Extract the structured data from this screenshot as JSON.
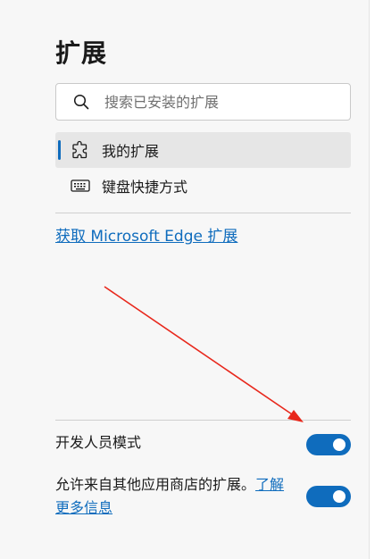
{
  "page": {
    "title": "扩展"
  },
  "search": {
    "placeholder": "搜索已安装的扩展",
    "value": ""
  },
  "nav": {
    "items": [
      {
        "label": "我的扩展",
        "icon": "puzzle-piece-icon",
        "selected": true
      },
      {
        "label": "键盘快捷方式",
        "icon": "keyboard-icon",
        "selected": false
      }
    ]
  },
  "links": {
    "get_extensions": "获取 Microsoft Edge 扩展"
  },
  "settings": {
    "developer_mode": {
      "label": "开发人员模式",
      "enabled": true
    },
    "other_stores": {
      "label_prefix": "允许来自其他应用商店的扩展。",
      "link_text": "了解更多信息",
      "enabled": true
    }
  },
  "colors": {
    "accent": "#0f6cbd",
    "annotation_arrow": "#e8281c",
    "panel_background": "#f7f7f7"
  }
}
